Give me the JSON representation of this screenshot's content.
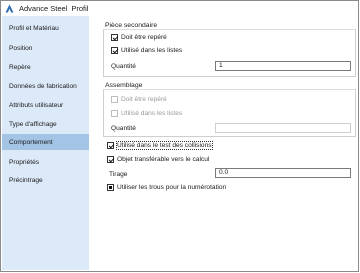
{
  "window": {
    "app_name": "Advance Steel",
    "dialog_title": "Profil"
  },
  "sidebar": {
    "items": [
      {
        "label": "Profil et Matériau"
      },
      {
        "label": "Position"
      },
      {
        "label": "Repère"
      },
      {
        "label": "Données de fabrication"
      },
      {
        "label": "Attributs utilisateur"
      },
      {
        "label": "Type d'affichage"
      },
      {
        "label": "Comportement"
      },
      {
        "label": "Propriétés"
      },
      {
        "label": "Précintrage"
      }
    ],
    "active_index": 6
  },
  "piece_secondaire": {
    "title": "Pièce secondaire",
    "doit_etre_repere": {
      "label": "Doit être repéré",
      "checked": true
    },
    "utilise_listes": {
      "label": "Utilisé dans les listes",
      "checked": true
    },
    "quantite_label": "Quantité",
    "quantite_value": "1"
  },
  "assemblage": {
    "title": "Assemblage",
    "doit_etre_repere": {
      "label": "Doit être repéré",
      "checked": false,
      "disabled": true
    },
    "utilise_listes": {
      "label": "Utilisé dans les listes",
      "checked": false,
      "disabled": true
    },
    "quantite_label": "Quantité",
    "quantite_value": ""
  },
  "behaviour": {
    "test_collisions": {
      "label": "Utilisé dans le test des collisions",
      "checked": true
    },
    "objet_transferable": {
      "label": "Objet transférable vers le calcul",
      "checked": true
    },
    "tirage_label": "Tirage",
    "tirage_value": "0.0",
    "trous_numerotation": {
      "label": "Utiliser les trous pour la numérotation",
      "checked": true
    }
  },
  "colors": {
    "sidebar_bg": "#dbe9f8",
    "sidebar_active": "#a4c4e6"
  },
  "icons": {
    "app_icon": "advance-steel-icon"
  }
}
